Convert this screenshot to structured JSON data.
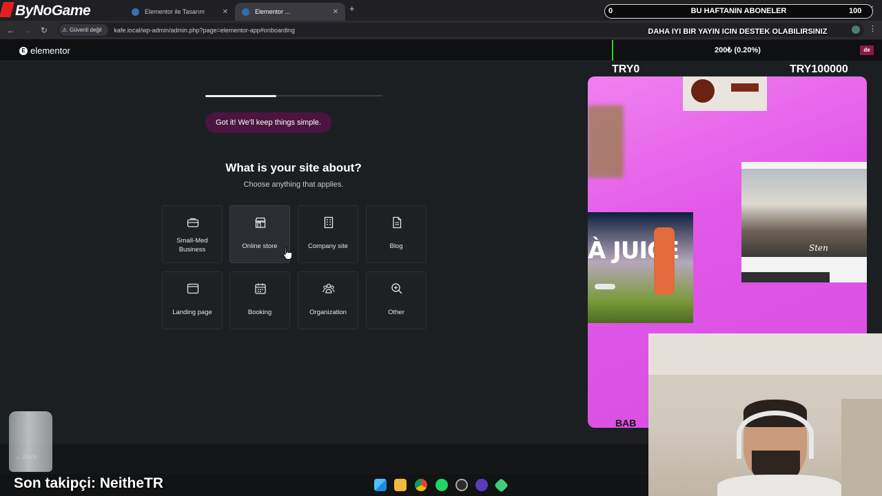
{
  "browser": {
    "tabs": [
      {
        "title": "Elementor ile Tasarım",
        "active": false
      },
      {
        "title": "Elementor ...",
        "active": true
      }
    ],
    "security_label": "Güvenli değil",
    "url": "kafe.local/wp-admin/admin.php?page=elementor-app#onboarding"
  },
  "elementor": {
    "logo_text": "elementor",
    "progress": 0.4,
    "message": "Got it! We'll keep things simple.",
    "question": "What is your site about?",
    "subtitle": "Choose anything that applies.",
    "options": [
      {
        "label": "Small-Med Business",
        "icon": "briefcase-icon"
      },
      {
        "label": "Online store",
        "icon": "store-icon",
        "hovered": true
      },
      {
        "label": "Company site",
        "icon": "building-icon"
      },
      {
        "label": "Blog",
        "icon": "document-icon"
      },
      {
        "label": "Landing page",
        "icon": "browser-window-icon"
      },
      {
        "label": "Booking",
        "icon": "calendar-icon"
      },
      {
        "label": "Organization",
        "icon": "people-icon"
      },
      {
        "label": "Other",
        "icon": "zoom-in-icon"
      }
    ],
    "back_label": "Back"
  },
  "stream": {
    "brand": "ByNoGame",
    "subs_left": "0",
    "subs_title": "BU HAFTANIN ABONELER",
    "subs_right": "100",
    "support_text": "DAHA IYI BIR YAYIN ICIN DESTEK OLABILIRSINIZ",
    "donation_value": "200₺ (0.20%)",
    "badge": "de",
    "range_min": "TRY0",
    "range_max": "TRY100000",
    "last_follower": "Son takipçi: NeitheTR"
  },
  "preview": {
    "headline": "À JUICE",
    "gallery_title": "Sten",
    "bottom_text": "BAB"
  },
  "colors": {
    "accent": "#4a1540",
    "preview_pink": "#e258e8",
    "donate_green": "#2bd12b"
  }
}
